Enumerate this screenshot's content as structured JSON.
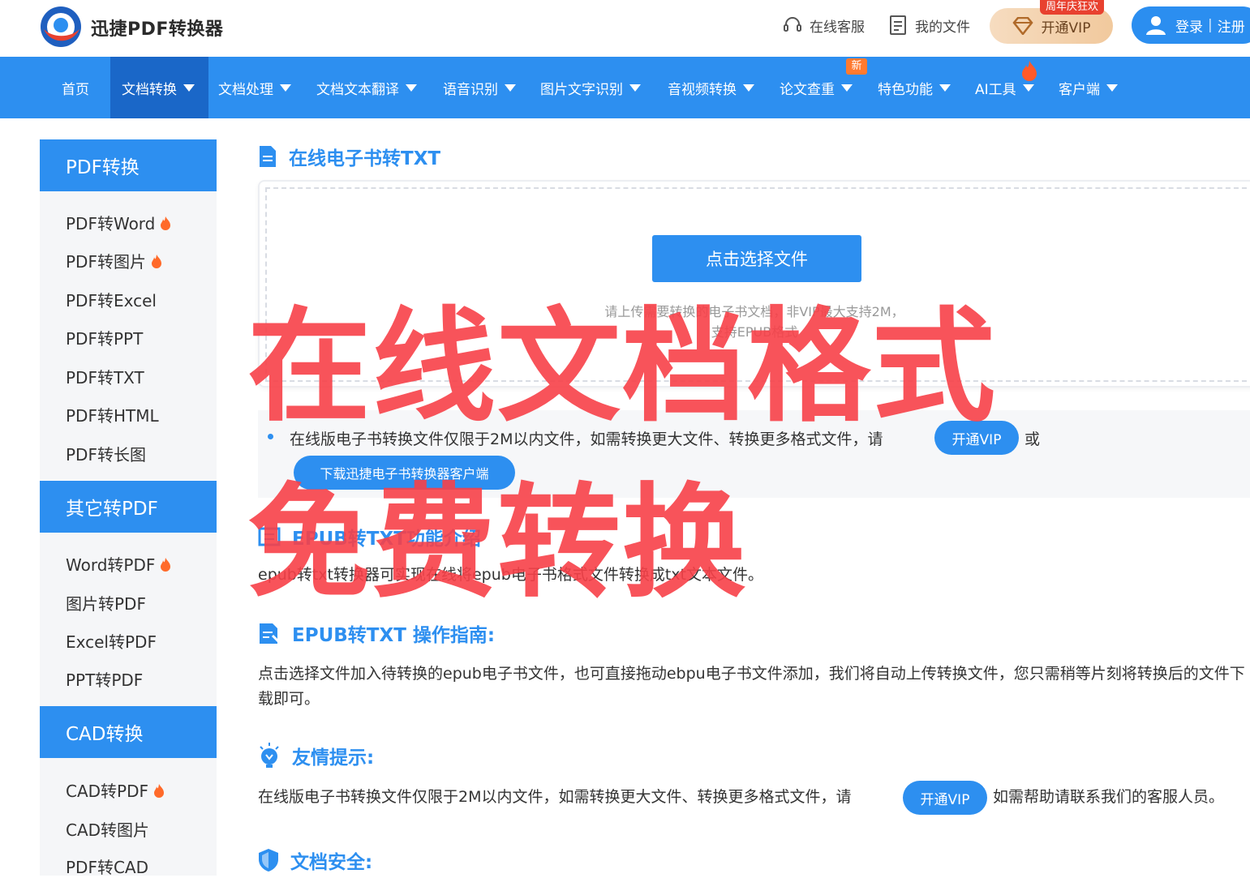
{
  "header": {
    "brand": "迅捷PDF转换器",
    "service_label": "在线客服",
    "files_label": "我的文件",
    "vip_badge": "周年庆狂欢",
    "vip_label": "开通VIP",
    "login_label": "登录",
    "register_label": "注册",
    "login_divider": "|"
  },
  "nav": {
    "items": [
      {
        "label": "首页"
      },
      {
        "label": "文档转换"
      },
      {
        "label": "文档处理"
      },
      {
        "label": "文档文本翻译"
      },
      {
        "label": "语音识别"
      },
      {
        "label": "图片文字识别"
      },
      {
        "label": "音视频转换"
      },
      {
        "label": "论文查重"
      },
      {
        "label": "特色功能"
      },
      {
        "label": "AI工具"
      },
      {
        "label": "客户端"
      }
    ],
    "new_badge": "新"
  },
  "sidebar": {
    "groups": [
      {
        "title": "PDF转换",
        "items": [
          {
            "label": "PDF转Word"
          },
          {
            "label": "PDF转图片"
          },
          {
            "label": "PDF转Excel"
          },
          {
            "label": "PDF转PPT"
          },
          {
            "label": "PDF转TXT"
          },
          {
            "label": "PDF转HTML"
          },
          {
            "label": "PDF转长图"
          }
        ]
      },
      {
        "title": "其它转PDF",
        "items": [
          {
            "label": "Word转PDF"
          },
          {
            "label": "图片转PDF"
          },
          {
            "label": "Excel转PDF"
          },
          {
            "label": "PPT转PDF"
          }
        ]
      },
      {
        "title": "CAD转换",
        "items": [
          {
            "label": "CAD转PDF"
          },
          {
            "label": "CAD转图片"
          },
          {
            "label": "PDF转CAD"
          }
        ]
      }
    ]
  },
  "main": {
    "title": "在线电子书转TXT",
    "choose_button": "点击选择文件",
    "hint_line1": "请上传需要转换的电子书文档，非VIP最大支持2M，",
    "hint_line2": "支持EPUB格式",
    "notice_text": "在线版电子书转换文件仅限于2M以内文件，如需转换更大文件、转换更多格式文件，请",
    "notice_vip": "开通VIP",
    "notice_or": "或",
    "download_button": "下载迅捷电子书转换器客户端",
    "func_title": "EPUB转TXT功能介绍",
    "func_text": "epub转txt转换器可实现在线将epub电子书格式文件转换成txt文本文件。",
    "guide_title": "EPUB转TXT 操作指南:",
    "guide_text": "点击选择文件加入待转换的epub电子书文件，也可直接拖动ebpu电子书文件添加，我们将自动上传转换文件，您只需稍等片刻将转换后的文件下载即可。",
    "tips_title": "友情提示:",
    "tips_text": "在线版电子书转换文件仅限于2M以内文件，如需转换更大文件、转换更多格式文件，请",
    "tips_vip": "开通VIP",
    "tips_after": "如需帮助请联系我们的客服人员。",
    "security_title": "文档安全:"
  },
  "overlay": {
    "line1": "在线文档格式",
    "line2": "免费转换"
  },
  "colors": {
    "primary": "#2d8ff0",
    "nav_active": "#1a67c8",
    "overlay_red": "#f74048",
    "fire": "#ff6a2a"
  }
}
